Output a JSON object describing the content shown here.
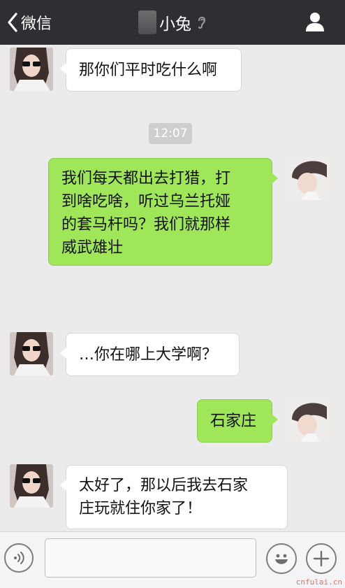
{
  "header": {
    "back_label": "微信",
    "title": "小兔",
    "icons": [
      "chevron-left-icon",
      "ear-icon",
      "profile-icon"
    ]
  },
  "messages": [
    {
      "side": "left",
      "text": "那你们平时吃什么啊"
    },
    {
      "type": "time",
      "text": "12:07"
    },
    {
      "side": "right",
      "lines": [
        "我们每天都出去打猎，打",
        "到啥吃啥，听过乌兰托娅",
        "的套马杆吗？我们就那样",
        "威武雄壮"
      ]
    },
    {
      "side": "left",
      "text": "…你在哪上大学啊？"
    },
    {
      "side": "right",
      "text": "石家庄"
    },
    {
      "side": "left",
      "lines": [
        "太好了，那以后我去石家",
        "庄玩就住你家了！"
      ]
    }
  ],
  "input": {
    "value": "",
    "placeholder": ""
  },
  "watermark": "cnfulai.cn",
  "colors": {
    "header_bg": "#2f2f33",
    "chat_bg": "#ebebeb",
    "outgoing_bubble": "#9fe658",
    "incoming_bubble": "#ffffff"
  }
}
